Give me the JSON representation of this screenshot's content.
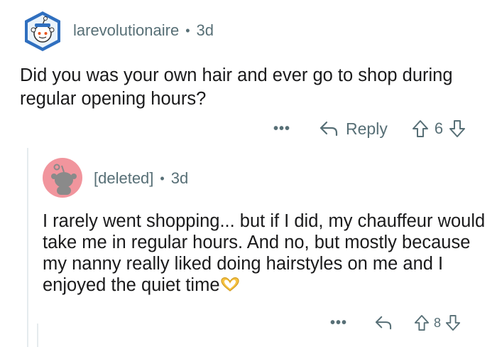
{
  "comment": {
    "username": "larevolutionaire",
    "separator": "•",
    "age": "3d",
    "text": "Did you was your own hair and ever go to shop during regular opening hours?",
    "more_label": "•••",
    "reply_label": "Reply",
    "score": "6"
  },
  "reply": {
    "username": "[deleted]",
    "separator": "•",
    "age": "3d",
    "text": "I rarely went shopping... but if I did, my chauffeur would take me in regular hours. And no, but mostly because my nanny really liked doing hairstyles on me and I enjoyed the quiet time",
    "emoji": "heart-hands-emoji",
    "more_label": "•••",
    "score": "8"
  },
  "colors": {
    "meta": "#576f76",
    "text": "#1a1a1b",
    "avatar_blue": "#2f6fbf",
    "deleted_avatar_bg": "#f1959d",
    "thread_line": "#e5ebee"
  }
}
